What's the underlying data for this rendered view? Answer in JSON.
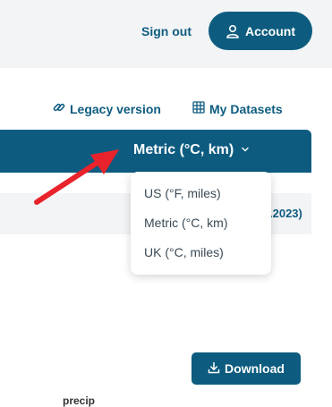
{
  "header": {
    "signout_label": "Sign out",
    "account_label": "Account",
    "account_icon": "user-icon",
    "accent_color": "#0d5c80"
  },
  "links": {
    "legacy_label": "Legacy version",
    "legacy_icon": "link-icon",
    "datasets_label": "My Datasets",
    "datasets_icon": "grid-icon"
  },
  "units": {
    "selected": "Metric (°C, km)",
    "options": [
      "US (°F, miles)",
      "Metric (°C, km)",
      "UK (°C, miles)"
    ]
  },
  "date_fragment": ".2023)",
  "download": {
    "label": "Download",
    "icon": "download-icon"
  },
  "table": {
    "column_label": "precip"
  },
  "annotation": {
    "arrow_color": "#e8232b"
  }
}
